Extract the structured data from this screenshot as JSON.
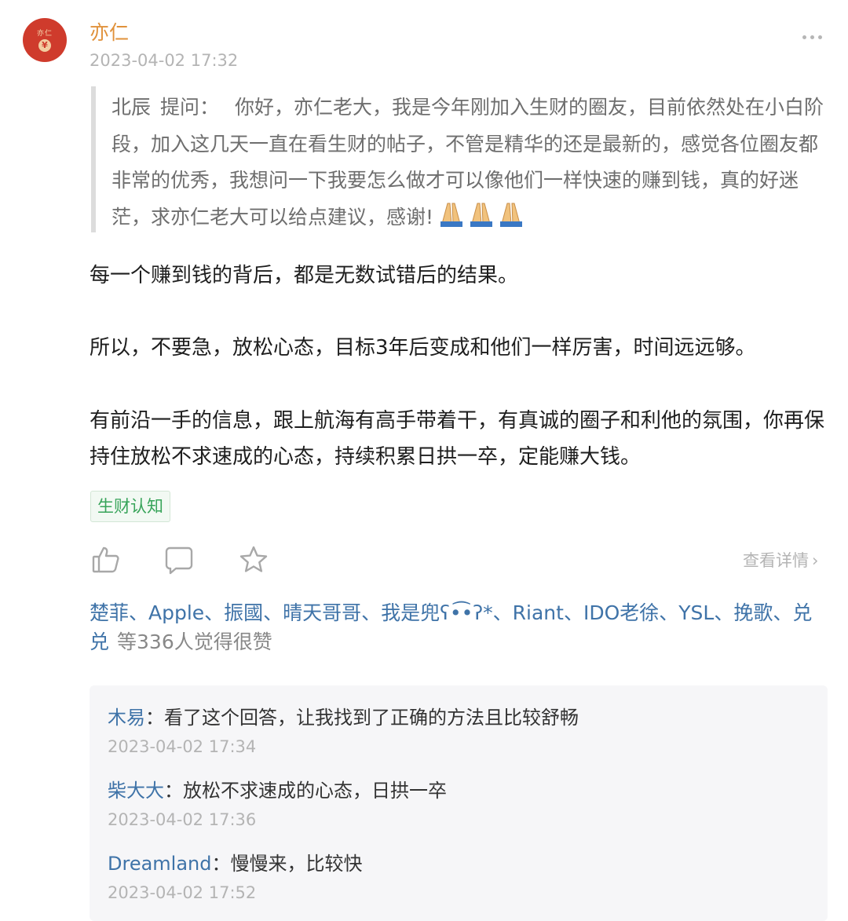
{
  "post": {
    "author": "亦仁",
    "avatar_text": "亦仁",
    "avatar_badge": "¥",
    "time": "2023-04-02 17:32",
    "more_icon": "more-dots-icon"
  },
  "question": {
    "asker": "北辰",
    "label": "提问：",
    "text": "你好，亦仁老大，我是今年刚加入生财的圈友，目前依然处在小白阶段，加入这几天一直在看生财的帖子，不管是精华的还是最新的，感觉各位圈友都非常的优秀，我想问一下我要怎么做才可以像他们一样快速的赚到钱，真的好迷茫，求亦仁老大可以给点建议，感谢!",
    "emoji": "praying-hands-icon"
  },
  "answer": {
    "paragraphs": [
      "每一个赚到钱的背后，都是无数试错后的结果。",
      "所以，不要急，放松心态，目标3年后变成和他们一样厉害，时间远远够。",
      "有前沿一手的信息，跟上航海有高手带着干，有真诚的圈子和利他的氛围，你再保持住放松不求速成的心态，持续积累日拱一卒，定能赚大钱。"
    ]
  },
  "tag": "生财认知",
  "actions": {
    "like_icon": "thumbs-up-icon",
    "comment_icon": "comment-icon",
    "favorite_icon": "star-icon",
    "view_detail": "查看详情",
    "chevron": "›"
  },
  "likes": {
    "names": "楚菲、Apple、振國、晴天哥哥、我是兜ʕ•͡•ʔ*、Riant、IDO老徐、YSL、挽歌、兑兑",
    "suffix": "等336人觉得很赞"
  },
  "comments": [
    {
      "name": "木易",
      "separator": "：",
      "text": "看了这个回答，让我找到了正确的方法且比较舒畅",
      "time": "2023-04-02 17:34"
    },
    {
      "name": "柴大大",
      "separator": "：",
      "text": "放松不求速成的心态，日拱一卒",
      "time": "2023-04-02 17:36"
    },
    {
      "name": "Dreamland",
      "separator": "：",
      "text": "慢慢来，比较快",
      "time": "2023-04-02 17:52"
    }
  ],
  "colors": {
    "author": "#e0913a",
    "link_blue": "#3f73a8",
    "tag_green": "#38a45a",
    "muted": "#b4b4b4",
    "avatar_red": "#cf3b2c"
  }
}
